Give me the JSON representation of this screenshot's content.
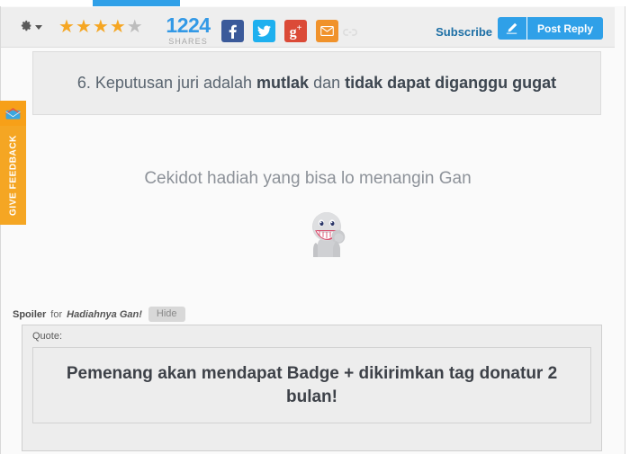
{
  "toolbar": {
    "gear_icon": "gear-icon",
    "gear_caret_icon": "chevron-down-icon",
    "rating": {
      "filled": 4,
      "total": 5
    },
    "shares_count": "1224",
    "shares_label": "SHARES",
    "social": [
      {
        "name": "facebook",
        "glyph": "f",
        "color": "#3b5a9a"
      },
      {
        "name": "twitter",
        "glyph": "bird",
        "color": "#1eb0ef"
      },
      {
        "name": "google-plus",
        "glyph": "g+",
        "color": "#db4a37"
      },
      {
        "name": "email",
        "glyph": "envelope",
        "color": "#f0922b"
      }
    ],
    "link_icon": "link-icon",
    "subscribe_label": "Subscribe",
    "pencil_icon": "pencil-icon",
    "post_reply_label": "Post Reply",
    "accent_color": "#2fa0e8",
    "subscribe_color": "#1d6fa5"
  },
  "feedback": {
    "label": "GIVE FEEDBACK",
    "icon": "envelope-icon",
    "color": "#f5a623"
  },
  "rule": {
    "number": "6.",
    "text_before": " Keputusan juri adalah ",
    "bold_1": "mutlak",
    "text_middle": " dan ",
    "bold_2": "tidak dapat diganggu gugat"
  },
  "post": {
    "headline": "Cekidot hadiah yang bisa lo menangin Gan",
    "emoticon": "smiling-character-emoticon"
  },
  "spoiler": {
    "word": "Spoiler",
    "for": "for",
    "title": "Hadiahnya Gan!",
    "hide_label": "Hide",
    "quote_label": "Quote:",
    "quote_text": "Pemenang akan mendapat Badge + dikirimkan tag donatur 2 bulan!"
  }
}
